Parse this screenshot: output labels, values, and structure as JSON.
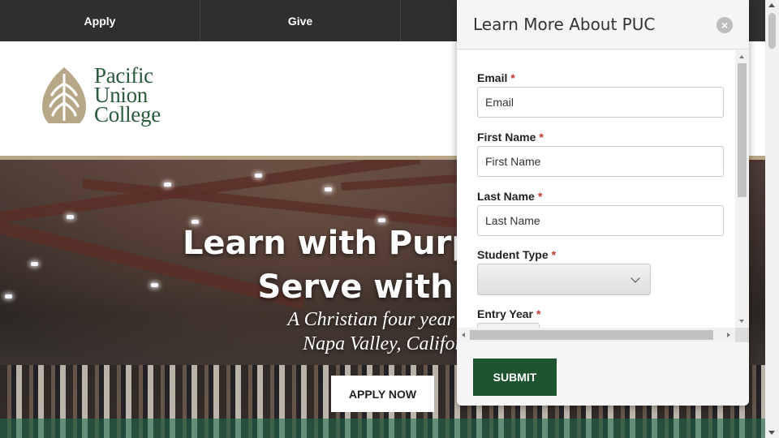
{
  "topnav": {
    "items": [
      "Apply",
      "Give",
      ""
    ]
  },
  "logo": {
    "line1": "Pacific",
    "line2": "Union",
    "line3": "College"
  },
  "hero": {
    "title_line1": "Learn with Purpose. L",
    "title_line2": "Serve with Lo",
    "subtitle_line1": "A Christian four year co",
    "subtitle_line2": "Napa Valley, Califor",
    "apply_label": "APPLY NOW"
  },
  "modal": {
    "title": "Learn More About PUC",
    "close_glyph": "×",
    "required_mark": "*",
    "fields": {
      "email": {
        "label": "Email",
        "placeholder": "Email"
      },
      "first_name": {
        "label": "First Name",
        "placeholder": "First Name"
      },
      "last_name": {
        "label": "Last Name",
        "placeholder": "Last Name"
      },
      "student_type": {
        "label": "Student Type",
        "value": ""
      },
      "entry_year": {
        "label": "Entry Year"
      }
    },
    "submit_label": "SUBMIT"
  },
  "colors": {
    "topbar": "#2f2f2f",
    "brand_green": "#2b5a3b",
    "brand_gold": "#b6a886",
    "submit_green": "#1f5431",
    "required_red": "#c0392b"
  },
  "icons": [
    "pacific-union-college-leaf-logo-icon",
    "close-icon",
    "chevron-down-icon"
  ]
}
